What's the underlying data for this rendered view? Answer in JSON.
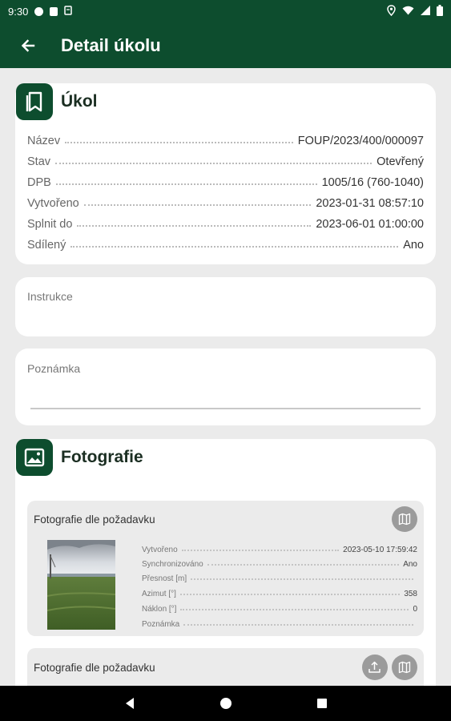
{
  "status_bar": {
    "time": "9:30",
    "left_icons": [
      "circle-icon",
      "sim-icon",
      "storage-icon"
    ],
    "right_icons": [
      "location-icon",
      "wifi-icon",
      "signal-icon",
      "battery-icon"
    ]
  },
  "app_bar": {
    "back_icon": "arrow-back-icon",
    "title": "Detail úkolu"
  },
  "task_card": {
    "icon": "bookmark-icon",
    "title": "Úkol",
    "rows": [
      {
        "label": "Název",
        "value": "FOUP/2023/400/000097"
      },
      {
        "label": "Stav",
        "value": "Otevřený"
      },
      {
        "label": "DPB",
        "value": "1005/16 (760-1040)"
      },
      {
        "label": "Vytvořeno",
        "value": "2023-01-31 08:57:10"
      },
      {
        "label": "Splnit do",
        "value": "2023-06-01 01:00:00"
      },
      {
        "label": "Sdílený",
        "value": "Ano"
      }
    ]
  },
  "instructions_card": {
    "label": "Instrukce",
    "value": ""
  },
  "note_card": {
    "label": "Poznámka",
    "value": ""
  },
  "photos_card": {
    "icon": "image-icon",
    "title": "Fotografie",
    "items": [
      {
        "title": "Fotografie dle požadavku",
        "buttons": [
          "map-icon"
        ],
        "details": [
          {
            "label": "Vytvořeno",
            "value": "2023-05-10 17:59:42"
          },
          {
            "label": "Synchronizováno",
            "value": "Ano"
          },
          {
            "label": "Přesnost [m]",
            "value": ""
          },
          {
            "label": "Azimut [°]",
            "value": "358"
          },
          {
            "label": "Náklon [°]",
            "value": "0"
          },
          {
            "label": "Poznámka",
            "value": ""
          }
        ]
      },
      {
        "title": "Fotografie dle požadavku",
        "buttons": [
          "sync-upload-icon",
          "map-icon"
        ]
      }
    ]
  },
  "nav_bar": {
    "buttons": [
      "back-triangle-icon",
      "home-circle-icon",
      "recents-square-icon"
    ]
  }
}
